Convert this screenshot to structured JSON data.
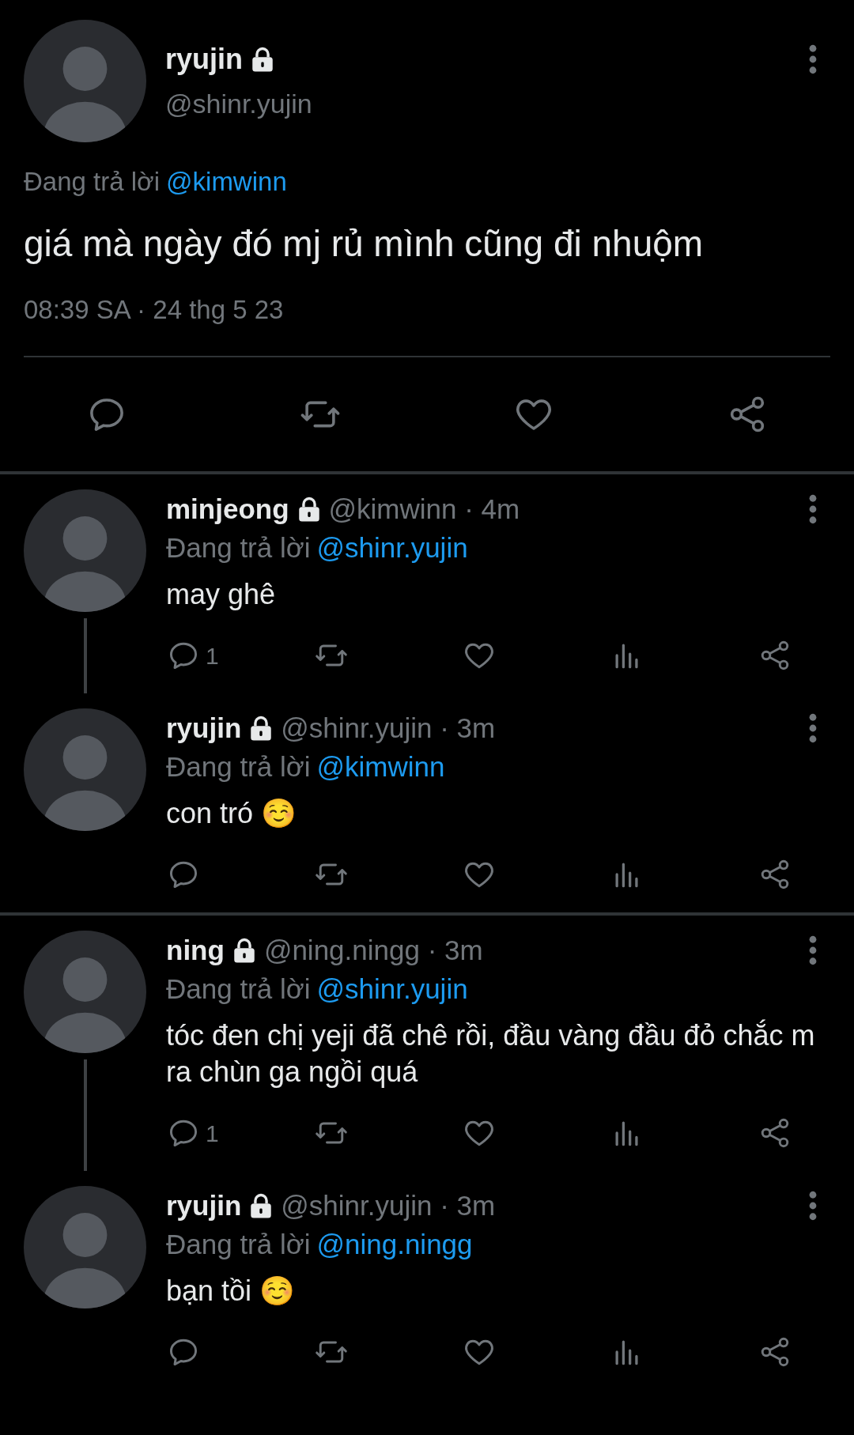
{
  "main_tweet": {
    "name": "ryujin",
    "locked": true,
    "handle": "@shinr.yujin",
    "replying_label": "Đang trả lời",
    "replying_to": "@kimwinn",
    "text": "giá mà ngày đó mj rủ mình cũng đi nhuộm",
    "timestamp": "08:39 SA · 24 thg 5 23",
    "actions": [
      {
        "kind": "reply"
      },
      {
        "kind": "retweet"
      },
      {
        "kind": "like"
      },
      {
        "kind": "share"
      }
    ]
  },
  "threads": [
    {
      "replies": [
        {
          "name": "minjeong",
          "locked": true,
          "meta": "@kimwinn · 4m",
          "replying_label": "Đang trả lời",
          "replying_to": "@shinr.yujin",
          "text": "may ghê",
          "actions": [
            {
              "kind": "reply",
              "count": "1"
            },
            {
              "kind": "retweet"
            },
            {
              "kind": "like"
            },
            {
              "kind": "views"
            },
            {
              "kind": "share"
            }
          ]
        },
        {
          "name": "ryujin",
          "locked": true,
          "meta": "@shinr.yujin · 3m",
          "replying_label": "Đang trả lời",
          "replying_to": "@kimwinn",
          "text": "con tró ☺️",
          "actions": [
            {
              "kind": "reply"
            },
            {
              "kind": "retweet"
            },
            {
              "kind": "like"
            },
            {
              "kind": "views"
            },
            {
              "kind": "share"
            }
          ]
        }
      ]
    },
    {
      "replies": [
        {
          "name": "ning",
          "locked": true,
          "meta": "@ning.ningg · 3m",
          "replying_label": "Đang trả lời",
          "replying_to": "@shinr.yujin",
          "text": "tóc đen chị yeji đã chê rồi, đầu vàng đầu đỏ chắc m ra chùn ga ngồi quá",
          "actions": [
            {
              "kind": "reply",
              "count": "1"
            },
            {
              "kind": "retweet"
            },
            {
              "kind": "like"
            },
            {
              "kind": "views"
            },
            {
              "kind": "share"
            }
          ]
        },
        {
          "name": "ryujin",
          "locked": true,
          "meta": "@shinr.yujin · 3m",
          "replying_label": "Đang trả lời",
          "replying_to": "@ning.ningg",
          "text": "bạn tồi ☺️",
          "actions": [
            {
              "kind": "reply"
            },
            {
              "kind": "retweet"
            },
            {
              "kind": "like"
            },
            {
              "kind": "views"
            },
            {
              "kind": "share"
            }
          ]
        }
      ]
    }
  ]
}
